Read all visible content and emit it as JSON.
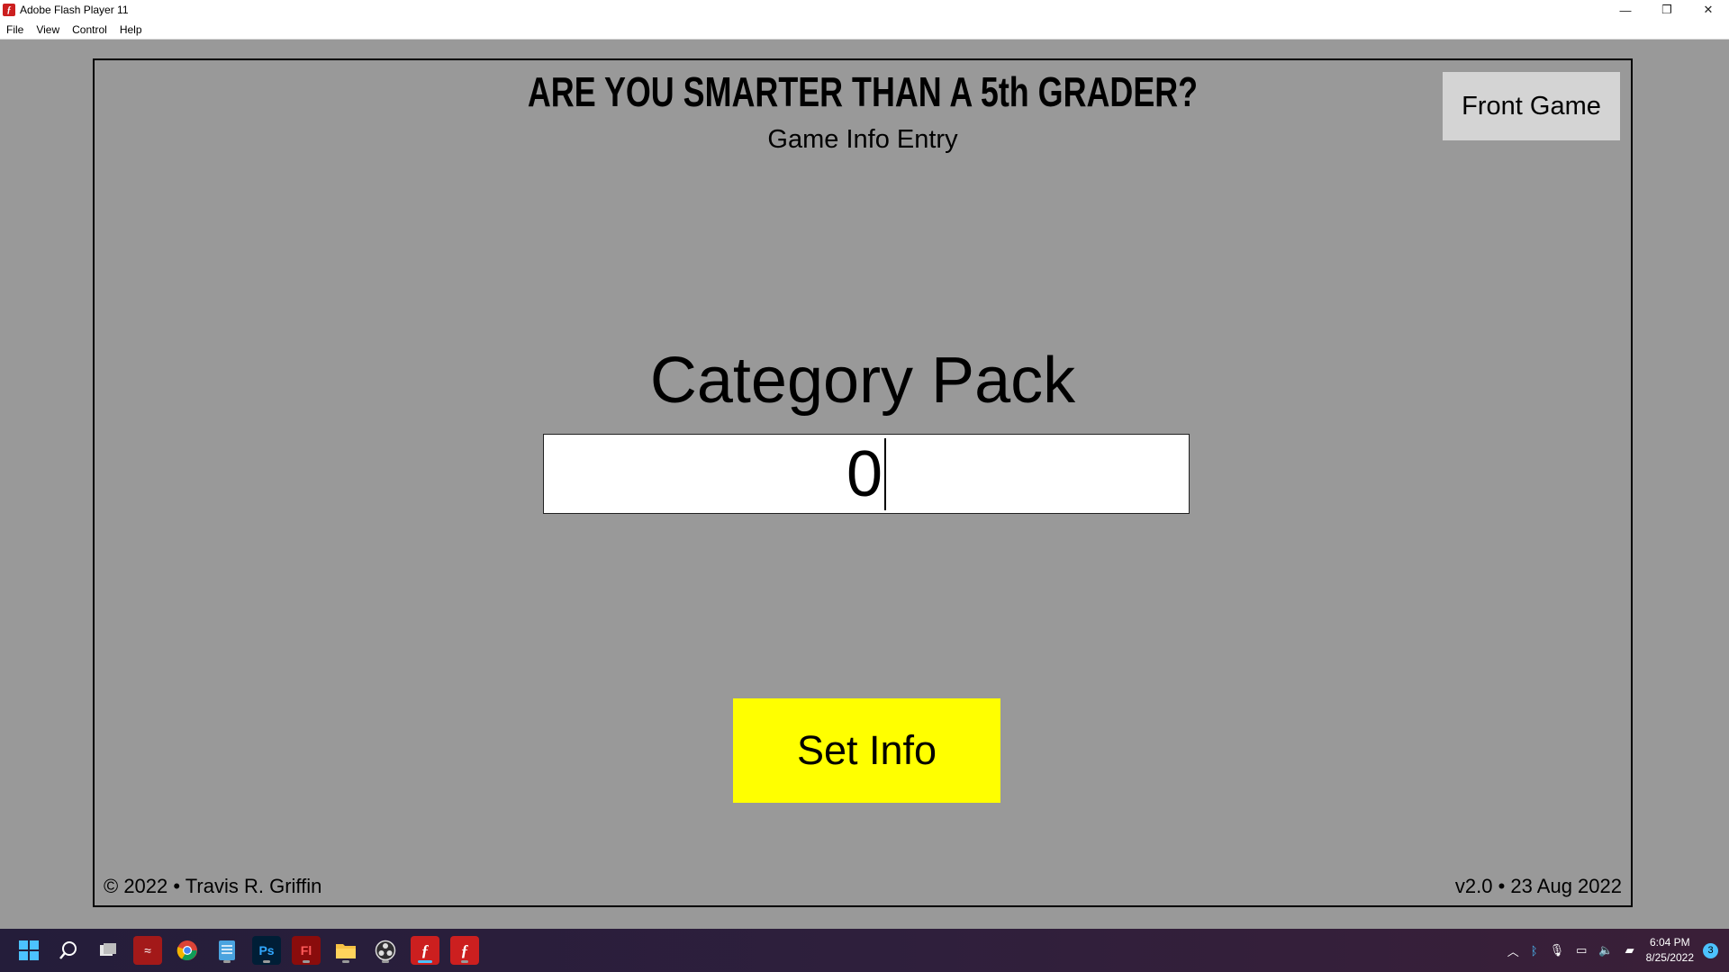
{
  "window": {
    "title": "Adobe Flash Player 11",
    "controls": {
      "minimize": "—",
      "restore": "❐",
      "close": "✕"
    }
  },
  "menu": [
    {
      "label": "File"
    },
    {
      "label": "View"
    },
    {
      "label": "Control"
    },
    {
      "label": "Help"
    }
  ],
  "game": {
    "title": "ARE YOU SMARTER THAN A 5th GRADER?",
    "subtitle": "Game Info Entry",
    "front_game_label": "Front Game",
    "field_label": "Category Pack",
    "field_value": "0",
    "set_info_label": "Set Info",
    "copyright": "© 2022 • Travis R. Griffin",
    "version": "v2.0 • 23 Aug 2022",
    "colors": {
      "stage_bg": "#999999",
      "set_info_bg": "#ffff00",
      "front_game_bg": "#d4d4d4"
    }
  },
  "taskbar": {
    "apps": [
      {
        "name": "start",
        "icon": "windows-logo-icon"
      },
      {
        "name": "search",
        "icon": "search-icon"
      },
      {
        "name": "task-view",
        "icon": "task-view-icon"
      },
      {
        "name": "app-red",
        "icon": "red-app-icon"
      },
      {
        "name": "chrome",
        "icon": "chrome-icon"
      },
      {
        "name": "notepad",
        "icon": "notepad-icon"
      },
      {
        "name": "photoshop",
        "icon": "photoshop-icon",
        "text": "Ps"
      },
      {
        "name": "flash-pro",
        "icon": "flash-pro-icon",
        "text": "Fl"
      },
      {
        "name": "file-explorer",
        "icon": "folder-icon"
      },
      {
        "name": "obs",
        "icon": "obs-icon"
      },
      {
        "name": "flash-player-active",
        "icon": "flash-player-icon"
      },
      {
        "name": "flash-player",
        "icon": "flash-player-icon"
      }
    ],
    "time": "6:04 PM",
    "date": "8/25/2022",
    "notification_count": "3"
  }
}
